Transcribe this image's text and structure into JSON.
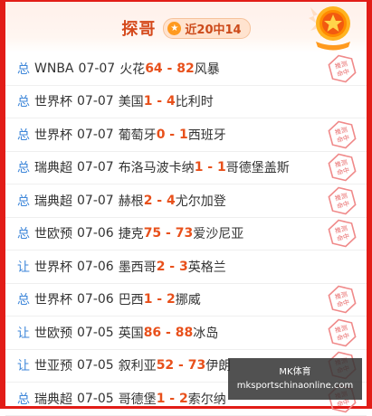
{
  "header": {
    "title": "探哥",
    "badge_text": "近20中14",
    "badge_icon": "star-icon",
    "medal_icon": "star-medal-icon"
  },
  "colors": {
    "frame": "#e21c17",
    "score": "#e8501b",
    "tag": "#3d86d9",
    "title": "#d54a1c"
  },
  "stamp_text": "推测命中",
  "rows": [
    {
      "tag": "总",
      "league": "WNBA",
      "date": "07-07",
      "home": "火花",
      "home_score": "64",
      "sep": " - ",
      "away_score": "82",
      "away": "风暴",
      "stamp": true
    },
    {
      "tag": "总",
      "league": "世界杯",
      "date": "07-07",
      "home": "美国",
      "home_score": "1",
      "sep": " - ",
      "away_score": "4",
      "away": "比利时",
      "stamp": false
    },
    {
      "tag": "总",
      "league": "世界杯",
      "date": "07-07",
      "home": "葡萄牙",
      "home_score": "0",
      "sep": " - ",
      "away_score": "1",
      "away": "西班牙",
      "stamp": true
    },
    {
      "tag": "总",
      "league": "瑞典超",
      "date": "07-07",
      "home": "布洛马波卡纳",
      "home_score": "1",
      "sep": " - ",
      "away_score": "1",
      "away": "哥德堡盖斯",
      "stamp": true
    },
    {
      "tag": "总",
      "league": "瑞典超",
      "date": "07-07",
      "home": "赫根",
      "home_score": "2",
      "sep": " - ",
      "away_score": "4",
      "away": "尤尔加登",
      "stamp": true
    },
    {
      "tag": "总",
      "league": "世欧预",
      "date": "07-06",
      "home": "捷克",
      "home_score": "75",
      "sep": " - ",
      "away_score": "73",
      "away": "爱沙尼亚",
      "stamp": true
    },
    {
      "tag": "让",
      "league": "世界杯",
      "date": "07-06",
      "home": "墨西哥",
      "home_score": "2",
      "sep": " - ",
      "away_score": "3",
      "away": "英格兰",
      "stamp": false
    },
    {
      "tag": "总",
      "league": "世界杯",
      "date": "07-06",
      "home": "巴西",
      "home_score": "1",
      "sep": " - ",
      "away_score": "2",
      "away": "挪威",
      "stamp": true
    },
    {
      "tag": "让",
      "league": "世欧预",
      "date": "07-05",
      "home": "英国",
      "home_score": "86",
      "sep": " - ",
      "away_score": "88",
      "away": "冰岛",
      "stamp": true
    },
    {
      "tag": "让",
      "league": "世亚预",
      "date": "07-05",
      "home": "叙利亚",
      "home_score": "52",
      "sep": " - ",
      "away_score": "73",
      "away": "伊朗",
      "stamp": true
    },
    {
      "tag": "总",
      "league": "瑞典超",
      "date": "07-05",
      "home": "哥德堡",
      "home_score": "1",
      "sep": " - ",
      "away_score": "2",
      "away": "索尔纳",
      "stamp": true
    }
  ],
  "watermark": {
    "line1": "MK体育",
    "line2": "mksportschinaonline.com"
  }
}
